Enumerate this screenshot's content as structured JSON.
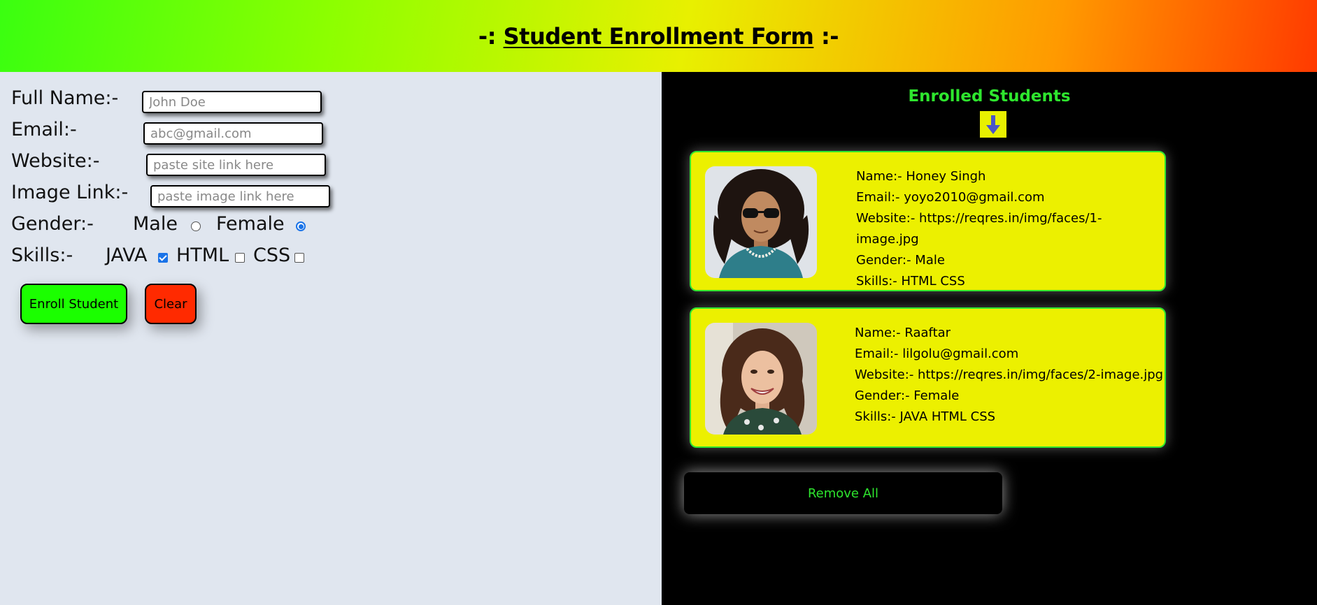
{
  "header": {
    "prefix": "-:",
    "title": "Student Enrollment Form",
    "suffix": ":-",
    "gradient_colors": [
      "#3aff10",
      "#e8f000",
      "#ff3a00"
    ]
  },
  "form": {
    "full_name": {
      "label": "Full Name:-",
      "placeholder": "John Doe",
      "value": ""
    },
    "email": {
      "label": "Email:-",
      "placeholder": "abc@gmail.com",
      "value": ""
    },
    "website": {
      "label": "Website:-",
      "placeholder": "paste site link here",
      "value": ""
    },
    "image_link": {
      "label": "Image Link:-",
      "placeholder": "paste image link here",
      "value": ""
    },
    "gender": {
      "label": "Gender:-",
      "options": [
        "Male",
        "Female"
      ],
      "selected": "Female"
    },
    "skills": {
      "label": "Skills:-",
      "options": [
        "JAVA",
        "HTML",
        "CSS"
      ],
      "checked": [
        "JAVA"
      ]
    },
    "enroll_label": "Enroll Student",
    "clear_label": "Clear"
  },
  "enrolled": {
    "title": "Enrolled Students",
    "arrow_icon": "arrow-down-icon",
    "students": [
      {
        "name": "Name:- Honey Singh",
        "email": "Email:- yoyo2010@gmail.com",
        "website": "Website:- https://reqres.in/img/faces/1-image.jpg",
        "gender": "Gender:- Male",
        "skills": "Skills:- HTML CSS"
      },
      {
        "name": "Name:- Raaftar",
        "email": "Email:- lilgolu@gmail.com",
        "website": "Website:- https://reqres.in/img/faces/2-image.jpg",
        "gender": "Gender:- Female",
        "skills": "Skills:- JAVA HTML CSS"
      }
    ],
    "remove_all_label": "Remove All"
  },
  "colors": {
    "accent_green": "#2ee62e",
    "card_yellow": "#ecf000",
    "clear_red": "#ff2a00",
    "enroll_green": "#1bff00"
  }
}
